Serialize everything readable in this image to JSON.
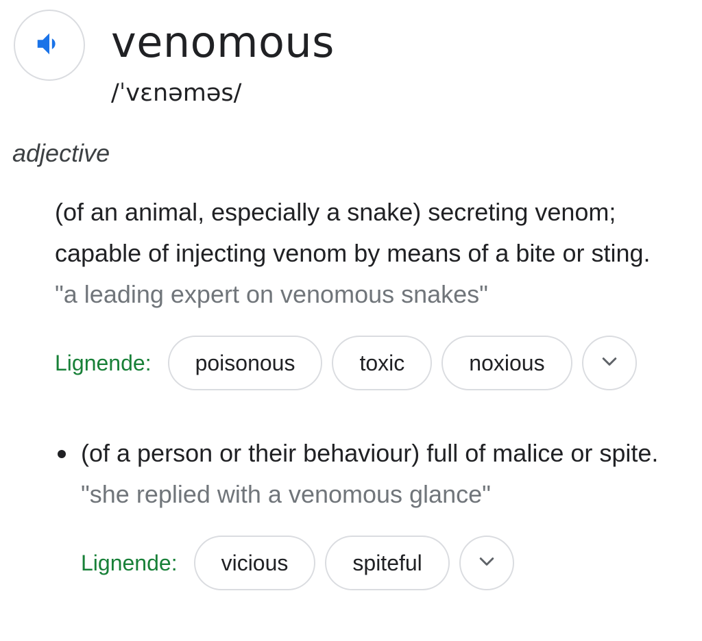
{
  "entry": {
    "word": "venomous",
    "phonetic": "/ˈvɛnəməs/",
    "part_of_speech": "adjective",
    "speaker_icon": "volume-up-icon",
    "accent_color": "#1a73e8"
  },
  "senses": [
    {
      "definition": "(of an animal, especially a snake) secreting venom; capable of injecting venom by means of a bite or sting.",
      "example": "\"a leading expert on venomous snakes\"",
      "synonyms_label": "Lignende:",
      "synonyms": [
        "poisonous",
        "toxic",
        "noxious"
      ],
      "more_icon": "chevron-down-icon"
    },
    {
      "definition": "(of a person or their behaviour) full of malice or spite.",
      "example": "\"she replied with a venomous glance\"",
      "synonyms_label": "Lignende:",
      "synonyms": [
        "vicious",
        "spiteful"
      ],
      "more_icon": "chevron-down-icon"
    }
  ],
  "colors": {
    "text": "#202124",
    "example": "#70757a",
    "synonym_label": "#188038",
    "border": "#dadce0"
  }
}
